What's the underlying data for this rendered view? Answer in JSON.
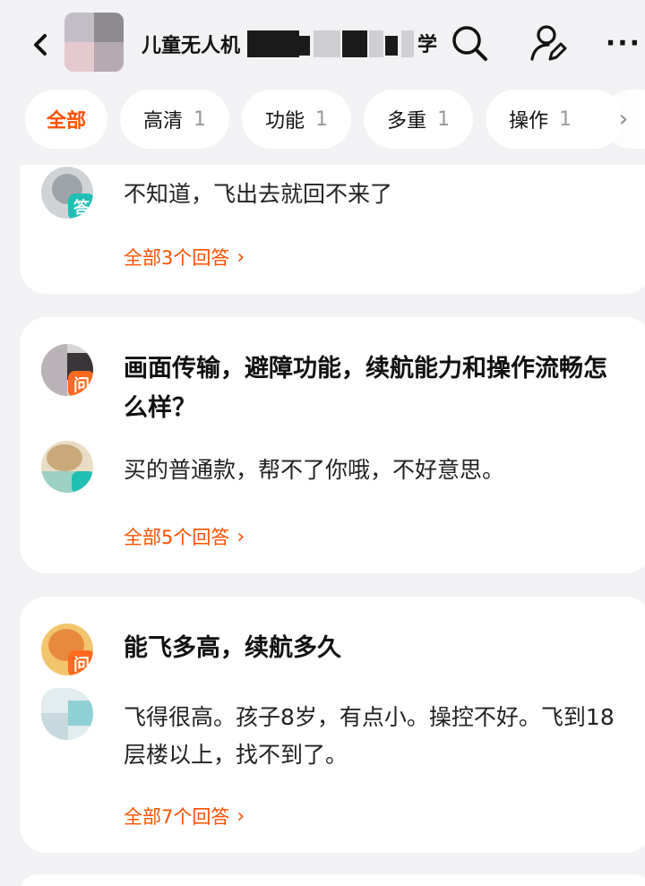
{
  "header": {
    "title": "儿童无人机",
    "title_tail": "学"
  },
  "tabs": [
    {
      "label": "全部",
      "count": ""
    },
    {
      "label": "高清",
      "count": "1"
    },
    {
      "label": "功能",
      "count": "1"
    },
    {
      "label": "多重",
      "count": "1"
    },
    {
      "label": "操作",
      "count": "1"
    }
  ],
  "tabs_more": "›",
  "cards": [
    {
      "answer": "不知道，飞出去就回不来了",
      "more": "全部3个回答",
      "answer_badge": "答"
    },
    {
      "question": "画面传输，避障功能，续航能力和操作流畅怎么样？",
      "question_badge": "问",
      "answer": "买的普通款，帮不了你哦，不好意思。",
      "more": "全部5个回答"
    },
    {
      "question": "能飞多高，续航多久",
      "question_badge": "问",
      "answer": "飞得很高。孩子8岁，有点小。操控不好。飞到18层楼以上，找不到了。",
      "more": "全部7个回答"
    }
  ],
  "colors": {
    "accent": "#ff5000",
    "answer_badge": "#20bfb4",
    "question_badge": "#ff6a1f"
  },
  "icons": [
    "back-icon",
    "search-icon",
    "user-edit-icon",
    "more-icon",
    "chevron-right-icon"
  ]
}
